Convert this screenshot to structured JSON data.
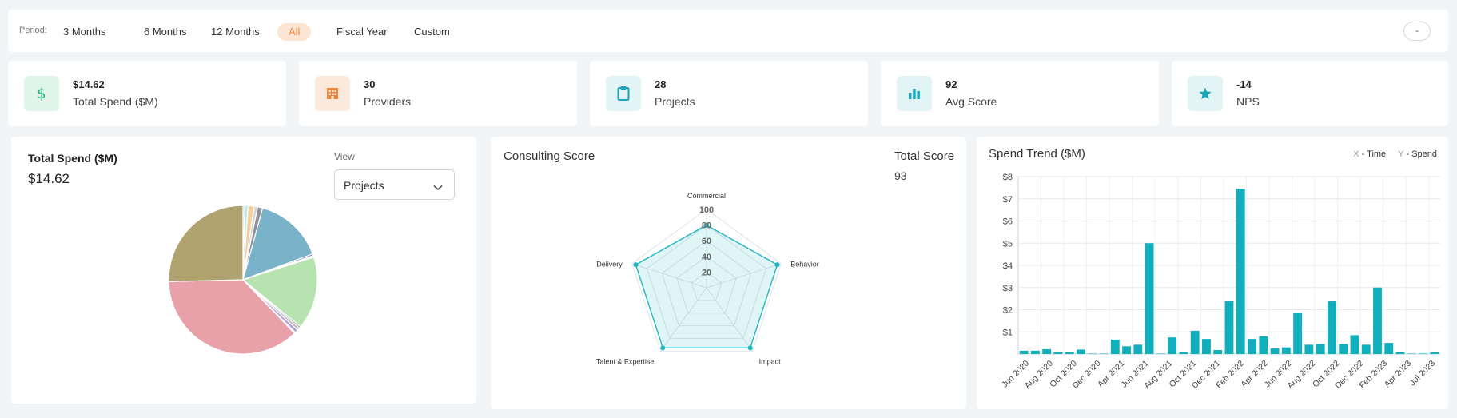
{
  "period": {
    "label": "Period:",
    "options": [
      {
        "label": "3 Months",
        "active": false
      },
      {
        "label": "6 Months",
        "active": false
      },
      {
        "label": "12 Months",
        "active": false
      },
      {
        "label": "All",
        "active": true
      },
      {
        "label": "Fiscal Year",
        "active": false
      },
      {
        "label": "Custom",
        "active": false
      }
    ],
    "right_button": "-"
  },
  "stats": [
    {
      "value": "$14.62",
      "label": "Total Spend ($M)",
      "icon": "dollar-icon",
      "color": "#1bb57a",
      "bg": "#dff5ea"
    },
    {
      "value": "30",
      "label": "Providers",
      "icon": "building-icon",
      "color": "#f0843a",
      "bg": "#fde9dc"
    },
    {
      "value": "28",
      "label": "Projects",
      "icon": "clipboard-icon",
      "color": "#1aa6b7",
      "bg": "#e3f4f6"
    },
    {
      "value": "92",
      "label": "Avg Score",
      "icon": "bar-chart-icon",
      "color": "#1aa6b7",
      "bg": "#e3f4f6"
    },
    {
      "value": "-14",
      "label": "NPS",
      "icon": "star-icon",
      "color": "#1aa6b7",
      "bg": "#e3f4f6"
    }
  ],
  "pie_card": {
    "title": "Total Spend ($M)",
    "total": "$14.62",
    "view_label": "View",
    "view_selected": "Projects"
  },
  "radar_card": {
    "title": "Consulting Score",
    "total_label": "Total Score",
    "total_value": "93"
  },
  "bar_card": {
    "title": "Spend Trend ($M)",
    "legend_x_key": "X",
    "legend_x": "- Time",
    "legend_y_key": "Y",
    "legend_y": "- Spend"
  },
  "chart_data": [
    {
      "type": "pie",
      "values": [
        0.05,
        0.1,
        0.18,
        0.1,
        0.15,
        2.05,
        0.05,
        0.05,
        2.15,
        0.05,
        0.08,
        0.1,
        0.03,
        5.0,
        3.45
      ],
      "colors": [
        "#a9dbe3",
        "#bfe8e8",
        "#f5cfa0",
        "#d6d6d6",
        "#8f9299",
        "#7ab3c9",
        "#5a6b8c",
        "#ffffff",
        "#b6e3b0",
        "#7d7d7d",
        "#bcbcbc",
        "#b8a1d9",
        "#cfc6ee",
        "#e8a1a8",
        "#b0a370"
      ]
    },
    {
      "type": "radar",
      "axes": [
        "Commercial",
        "Behavior",
        "Impact",
        "Talent & Expertise",
        "Delivery"
      ],
      "values": [
        80,
        95,
        95,
        95,
        95
      ],
      "range": [
        0,
        100
      ],
      "ticks": [
        "20",
        "40",
        "60",
        "80",
        "100"
      ],
      "color": "#22b5c2"
    },
    {
      "type": "bar",
      "ylim": [
        0,
        8
      ],
      "y_ticks": [
        "$1",
        "$2",
        "$3",
        "$4",
        "$5",
        "$6",
        "$7",
        "$8"
      ],
      "x_tick_labels": [
        "Jun 2020",
        "Aug 2020",
        "Oct 2020",
        "Dec 2020",
        "Apr 2021",
        "Jun 2021",
        "Aug 2021",
        "Oct 2021",
        "Dec 2021",
        "Feb 2022",
        "Apr 2022",
        "Jun 2022",
        "Aug 2022",
        "Oct 2022",
        "Dec 2022",
        "Feb 2023",
        "Apr 2023",
        "Jul 2023"
      ],
      "values": [
        0.15,
        0.15,
        0.22,
        0.1,
        0.08,
        0.2,
        0.02,
        0.02,
        0.65,
        0.35,
        0.42,
        5.0,
        0.02,
        0.75,
        0.1,
        1.05,
        0.68,
        0.18,
        2.4,
        7.45,
        0.68,
        0.8,
        0.25,
        0.3,
        1.85,
        0.42,
        0.45,
        2.4,
        0.45,
        0.85,
        0.42,
        3.0,
        0.5,
        0.1,
        0.02,
        0.02,
        0.08
      ],
      "color": "#11aebc"
    }
  ]
}
